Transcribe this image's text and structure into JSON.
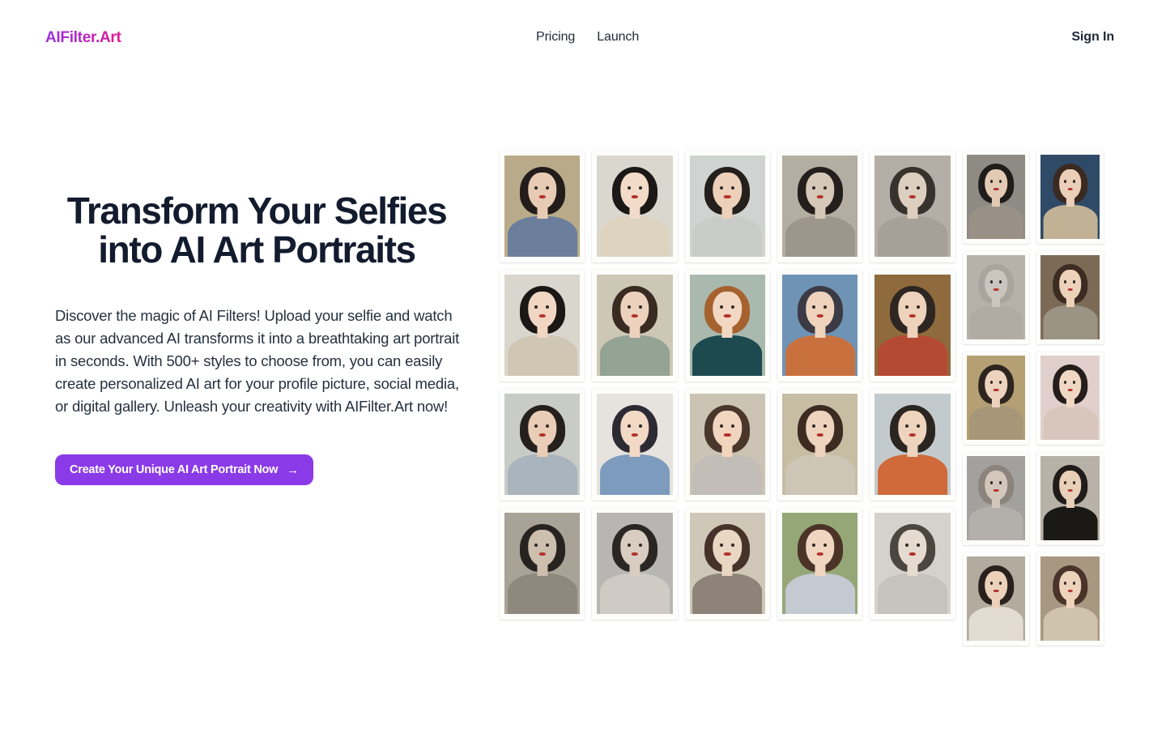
{
  "header": {
    "logo_text": "AIFilter.Art",
    "nav_links": [
      {
        "label": "Pricing"
      },
      {
        "label": "Launch"
      }
    ],
    "signin_label": "Sign In"
  },
  "hero": {
    "title": "Transform Your Selfies into AI Art Portraits",
    "paragraph": "Discover the magic of AI Filters! Upload your selfie and watch as our advanced AI transforms it into a breathtaking art portrait in seconds. With 500+ styles to choose from, you can easily create personalized AI art for your profile picture, social media, or digital gallery. Unleash your creativity with AIFilter.Art now!",
    "cta_label": "Create Your Unique AI Art Portrait Now",
    "cta_arrow": "→"
  },
  "colors": {
    "accent_purple": "#8b3ae8",
    "logo_gradient_start": "#9b30d9",
    "logo_gradient_end": "#e6138f",
    "heading_navy": "#131b2e",
    "page_background": "#ffffff"
  },
  "gallery": {
    "large_columns": [
      {
        "tiles": [
          {
            "style": "vintage-portrait-blue-vest",
            "bg": "#b9ab8a",
            "hair": "#221d1b",
            "face": "#e8cbb4",
            "body": "#6b7f9c"
          },
          {
            "style": "watercolor-lady-with-hat",
            "bg": "#d9d6cd",
            "hair": "#1a1715",
            "face": "#f0d6c3",
            "body": "#cfc7b4"
          },
          {
            "style": "cubist-geometric-portrait",
            "bg": "#c8cbc6",
            "hair": "#25201d",
            "face": "#e9cdb6",
            "body": "#a9b4bd"
          },
          {
            "style": "charcoal-sketch-portrait",
            "bg": "#a9a296",
            "hair": "#272320",
            "face": "#cdbfae",
            "body": "#8f887d"
          }
        ]
      },
      {
        "tiles": [
          {
            "style": "ink-wash-hat-portrait",
            "bg": "#dad7cf",
            "hair": "#1b1815",
            "face": "#f2dcc9",
            "body": "#ddd3bf"
          },
          {
            "style": "oil-painting-green-shawl",
            "bg": "#cdc8b6",
            "hair": "#3a2b22",
            "face": "#ecd2bd",
            "body": "#93a394"
          },
          {
            "style": "impressionist-blue-strokes",
            "bg": "#e6e3de",
            "hair": "#2c2a33",
            "face": "#f2d9c6",
            "body": "#7d9cbd"
          },
          {
            "style": "monochrome-ruffle-collar",
            "bg": "#b8b6b2",
            "hair": "#2a2623",
            "face": "#d9cdc1",
            "body": "#cfcac4"
          }
        ]
      },
      {
        "tiles": [
          {
            "style": "abstract-color-blocks",
            "bg": "#cfd3d2",
            "hair": "#241f1c",
            "face": "#ecd0ba",
            "body": "#c9ccc8"
          },
          {
            "style": "pointillist-teal-dress",
            "bg": "#aab9ad",
            "hair": "#a5622f",
            "face": "#f2d7c3",
            "body": "#1d4a4f"
          },
          {
            "style": "soft-pastel-grey-robe",
            "bg": "#cbc3b4",
            "hair": "#4a372c",
            "face": "#f1d5bf",
            "body": "#c2bdb6"
          },
          {
            "style": "pencil-sketch-suit",
            "bg": "#cfc8b9",
            "hair": "#463228",
            "face": "#e9d6c3",
            "body": "#8d8378"
          }
        ]
      },
      {
        "tiles": [
          {
            "style": "linework-grey-portrait",
            "bg": "#b3ada2",
            "hair": "#241f1c",
            "face": "#d6c8b8",
            "body": "#9d968b"
          },
          {
            "style": "fauvist-floral-background",
            "bg": "#6f93b5",
            "hair": "#3b3a45",
            "face": "#f0d3bd",
            "body": "#c9713e"
          },
          {
            "style": "classic-beige-portrait",
            "bg": "#c6bda3",
            "hair": "#3d2a21",
            "face": "#eed4bf",
            "body": "#cdc6b6"
          },
          {
            "style": "green-backdrop-portrait",
            "bg": "#95a777",
            "hair": "#4b3427",
            "face": "#f0d6c1",
            "body": "#c3cad2"
          }
        ]
      },
      {
        "tiles": [
          {
            "style": "graphite-curly-hair",
            "bg": "#b4afa6",
            "hair": "#38322d",
            "face": "#ddcfc0",
            "body": "#a7a099"
          },
          {
            "style": "gold-tapestry-portrait",
            "bg": "#8f6a3c",
            "hair": "#2d2622",
            "face": "#eed3bc",
            "body": "#b54a33"
          },
          {
            "style": "retro-stripes-portrait",
            "bg": "#c3cacd",
            "hair": "#2b2521",
            "face": "#eed3bd",
            "body": "#d06a3a"
          },
          {
            "style": "silver-rays-portrait",
            "bg": "#d5d2cc",
            "hair": "#4b463f",
            "face": "#e6dbd0",
            "body": "#c6c3bd"
          }
        ]
      }
    ],
    "small_columns": [
      {
        "tiles": [
          {
            "style": "dark-hair-soft-light",
            "bg": "#8e8a84",
            "hair": "#201c1a",
            "face": "#e3cab4",
            "body": "#9a9186"
          },
          {
            "style": "sculpture-stone-portrait",
            "bg": "#b6b2aa",
            "hair": "#a9a49c",
            "face": "#cac5bd",
            "body": "#b1aca3"
          },
          {
            "style": "golden-reed-background",
            "bg": "#b5a073",
            "hair": "#2e2520",
            "face": "#edd3bd",
            "body": "#a79778"
          },
          {
            "style": "silver-wave-hair-portrait",
            "bg": "#a3a19d",
            "hair": "#8b847c",
            "face": "#d3c7bb",
            "body": "#b3b0ab"
          },
          {
            "style": "soft-white-blouse-portrait",
            "bg": "#b3ab9e",
            "hair": "#2a211c",
            "face": "#ecd2bb",
            "body": "#e2dcd2"
          }
        ]
      },
      {
        "tiles": [
          {
            "style": "navy-backdrop-portrait",
            "bg": "#2f4a66",
            "hair": "#3a2a21",
            "face": "#eccfb8",
            "body": "#c2b295"
          },
          {
            "style": "textured-wall-portrait",
            "bg": "#7c6a57",
            "hair": "#3c2c22",
            "face": "#edd2ba",
            "body": "#9b9383"
          },
          {
            "style": "floral-wallpaper-portrait",
            "bg": "#e0cfcb",
            "hair": "#241d1a",
            "face": "#f0d7c3",
            "body": "#d8c6bd"
          },
          {
            "style": "black-dress-dark-hair",
            "bg": "#b7b1a7",
            "hair": "#211c19",
            "face": "#e8cfb8",
            "body": "#1b1916"
          },
          {
            "style": "updo-hair-beige-portrait",
            "bg": "#a89781",
            "hair": "#4a3328",
            "face": "#eed3bc",
            "body": "#cfc3ae"
          }
        ]
      }
    ]
  }
}
